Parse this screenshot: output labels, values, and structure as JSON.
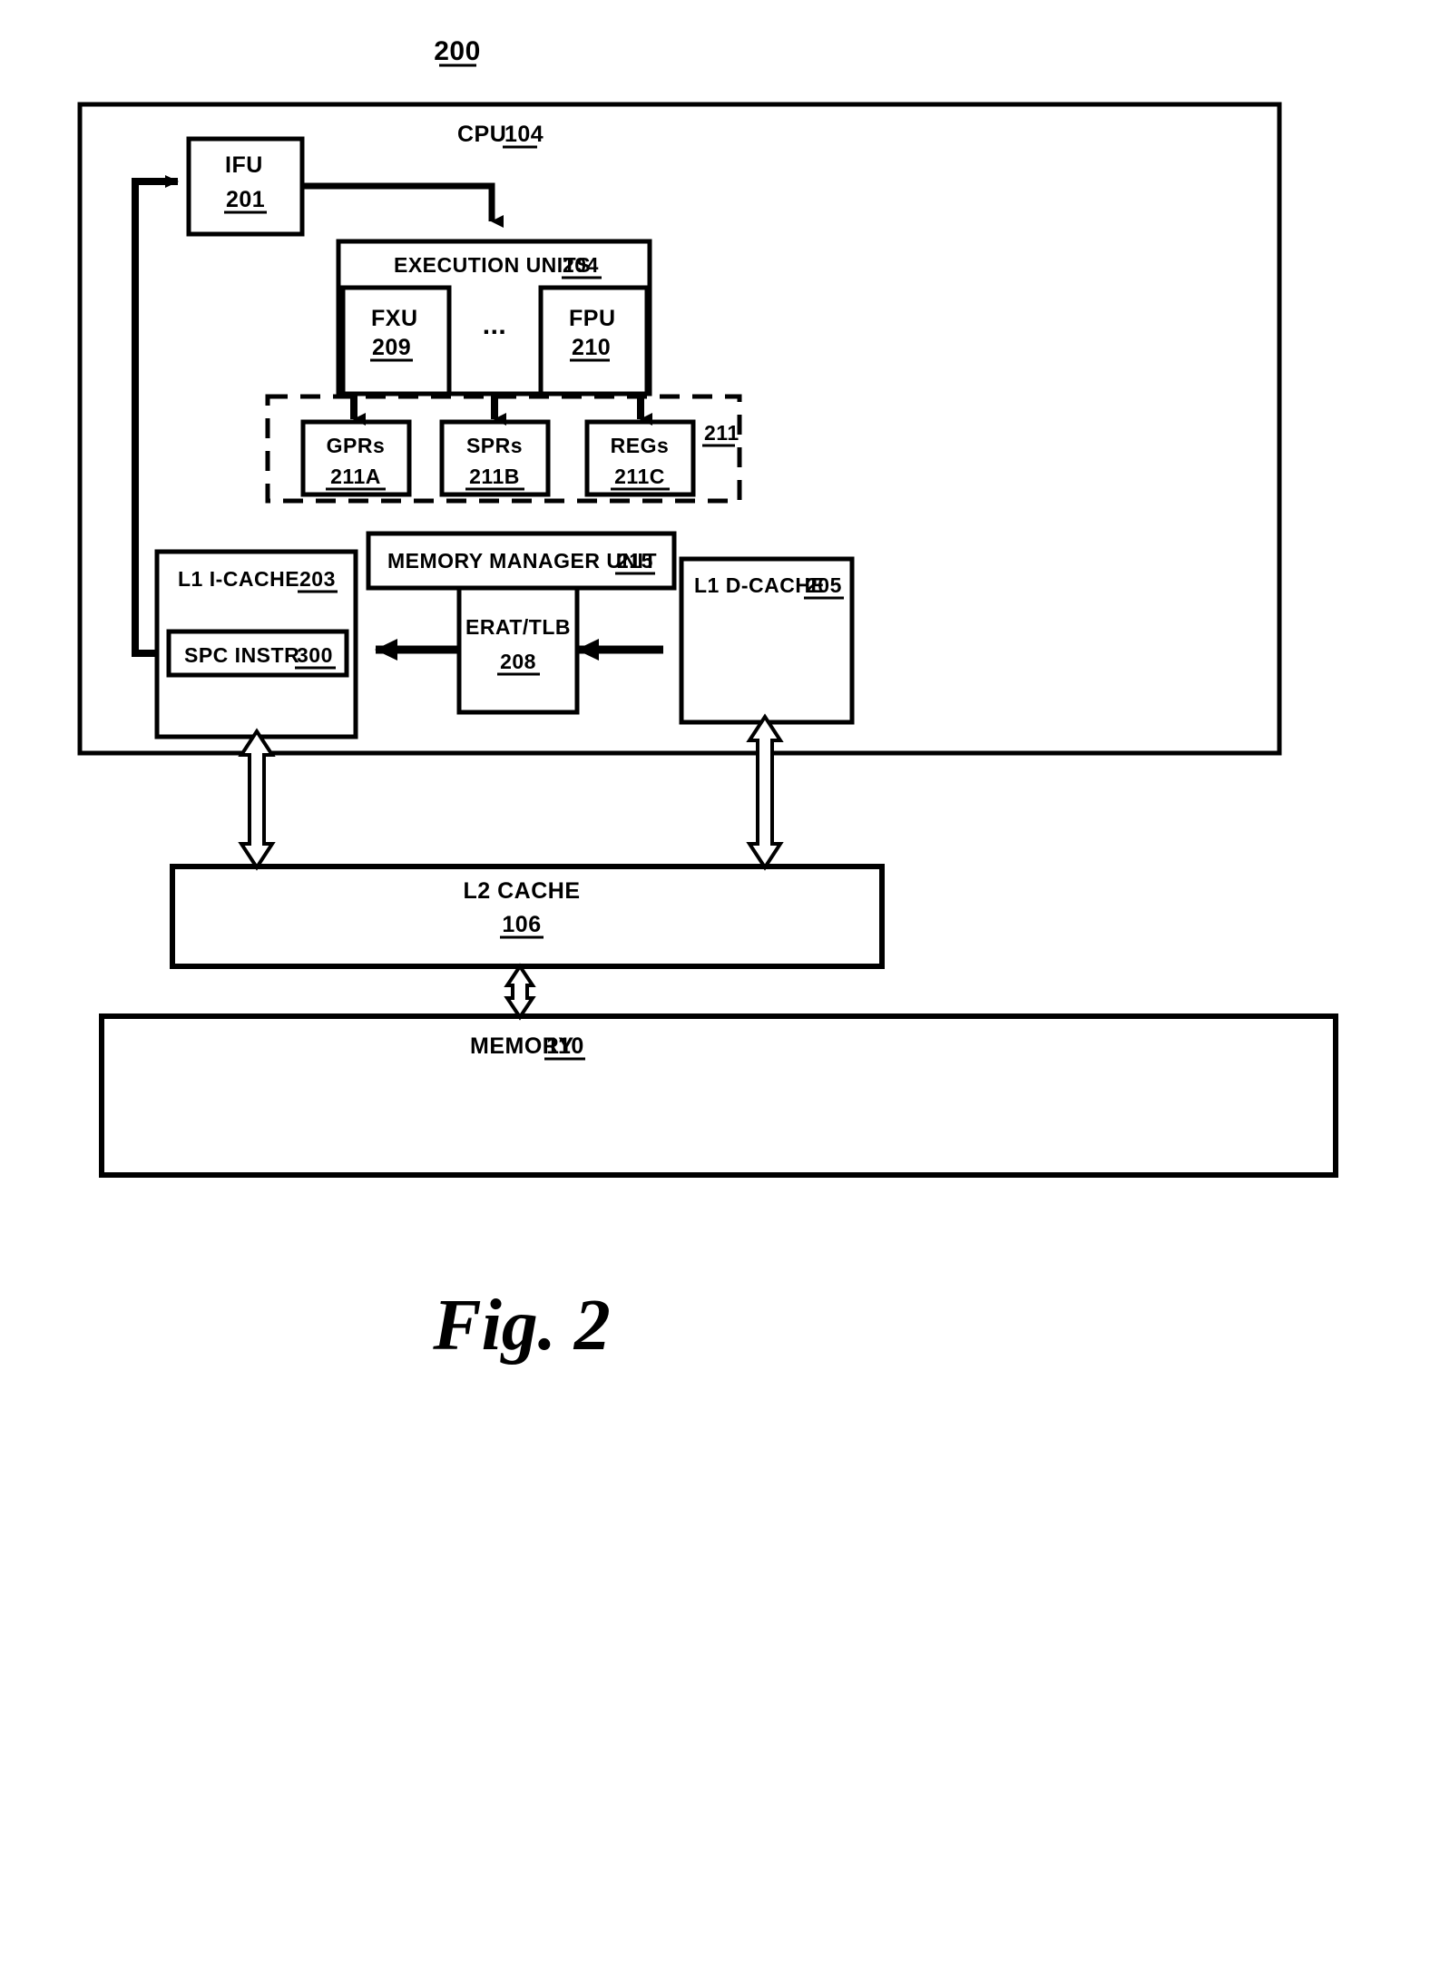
{
  "figure": {
    "number_label": "200",
    "caption": "Fig. 2"
  },
  "cpu": {
    "title_text": "CPU",
    "title_ref": "104",
    "ifu": {
      "name": "IFU",
      "ref": "201"
    },
    "execution_units": {
      "name": "EXECUTION UNITS",
      "ref": "204",
      "ellipsis": "...",
      "units": [
        {
          "name": "FXU",
          "ref": "209"
        },
        {
          "name": "FPU",
          "ref": "210"
        }
      ]
    },
    "registers_group": {
      "ref": "211",
      "registers": [
        {
          "name": "GPRs",
          "ref": "211A"
        },
        {
          "name": "SPRs",
          "ref": "211B"
        },
        {
          "name": "REGs",
          "ref": "211C"
        }
      ]
    },
    "l1_icache": {
      "name": "L1  I-CACHE",
      "ref": "203",
      "inner": {
        "name": "SPC INSTR",
        "ref": "300"
      }
    },
    "mmu": {
      "name": "MEMORY MANAGER UNIT",
      "ref": "215",
      "erat_tlb": {
        "name": "ERAT/TLB",
        "ref": "208"
      }
    },
    "l1_dcache": {
      "name": "L1  D-CACHE",
      "ref": "205"
    }
  },
  "l2_cache": {
    "name": "L2 CACHE",
    "ref": "106"
  },
  "memory": {
    "name": "MEMORY",
    "ref": "110"
  }
}
